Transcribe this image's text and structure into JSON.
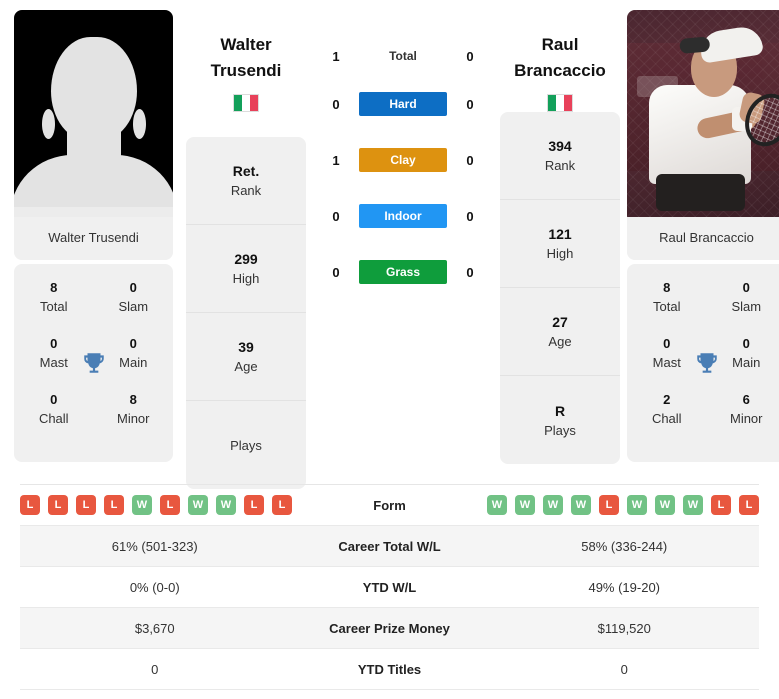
{
  "players": {
    "left": {
      "first_name": "Walter",
      "last_name": "Trusendi",
      "full_name": "Walter Trusendi",
      "country_flag": "italy-flag",
      "photo": "player-placeholder-silhouette",
      "rank": "Ret.",
      "rank_label": "Rank",
      "high": "299",
      "high_label": "High",
      "age": "39",
      "age_label": "Age",
      "plays": "",
      "plays_label": "Plays",
      "titles": {
        "total": "8",
        "total_label": "Total",
        "slam": "0",
        "slam_label": "Slam",
        "mast": "0",
        "mast_label": "Mast",
        "main": "0",
        "main_label": "Main",
        "chall": "0",
        "chall_label": "Chall",
        "minor": "8",
        "minor_label": "Minor"
      },
      "form": [
        "L",
        "L",
        "L",
        "L",
        "W",
        "L",
        "W",
        "W",
        "L",
        "L"
      ],
      "career_wl": "61% (501-323)",
      "ytd_wl": "0% (0-0)",
      "prize_money": "$3,670",
      "ytd_titles": "0"
    },
    "right": {
      "first_name": "Raul",
      "last_name": "Brancaccio",
      "full_name": "Raul Brancaccio",
      "country_flag": "italy-flag",
      "photo": "player-action-photo",
      "rank": "394",
      "rank_label": "Rank",
      "high": "121",
      "high_label": "High",
      "age": "27",
      "age_label": "Age",
      "plays": "R",
      "plays_label": "Plays",
      "titles": {
        "total": "8",
        "total_label": "Total",
        "slam": "0",
        "slam_label": "Slam",
        "mast": "0",
        "mast_label": "Mast",
        "main": "0",
        "main_label": "Main",
        "chall": "2",
        "chall_label": "Chall",
        "minor": "6",
        "minor_label": "Minor"
      },
      "form": [
        "W",
        "W",
        "W",
        "W",
        "L",
        "W",
        "W",
        "W",
        "L",
        "L"
      ],
      "career_wl": "58% (336-244)",
      "ytd_wl": "49% (19-20)",
      "prize_money": "$119,520",
      "ytd_titles": "0"
    }
  },
  "h2h": {
    "total": {
      "label": "Total",
      "left": "1",
      "right": "0"
    },
    "surfaces": [
      {
        "label": "Hard",
        "left": "0",
        "right": "0",
        "color": "#0d6ec4"
      },
      {
        "label": "Clay",
        "left": "1",
        "right": "0",
        "color": "#dd9210"
      },
      {
        "label": "Indoor",
        "left": "0",
        "right": "0",
        "color": "#2196f3"
      },
      {
        "label": "Grass",
        "left": "0",
        "right": "0",
        "color": "#0f9d3c"
      }
    ]
  },
  "stats_table": {
    "rows": [
      {
        "label": "Form",
        "type": "form"
      },
      {
        "label": "Career Total W/L",
        "type": "text"
      },
      {
        "label": "YTD W/L",
        "type": "text"
      },
      {
        "label": "Career Prize Money",
        "type": "text"
      },
      {
        "label": "YTD Titles",
        "type": "text"
      }
    ]
  },
  "colors": {
    "win_badge": "#71c285",
    "loss_badge": "#e8573f",
    "trophy": "#4a7eb5",
    "card_bg": "#f0f0f0",
    "row_alt_bg": "#f5f5f5"
  },
  "icons": {
    "trophy": "trophy-icon",
    "flag": "italy-flag-icon"
  }
}
